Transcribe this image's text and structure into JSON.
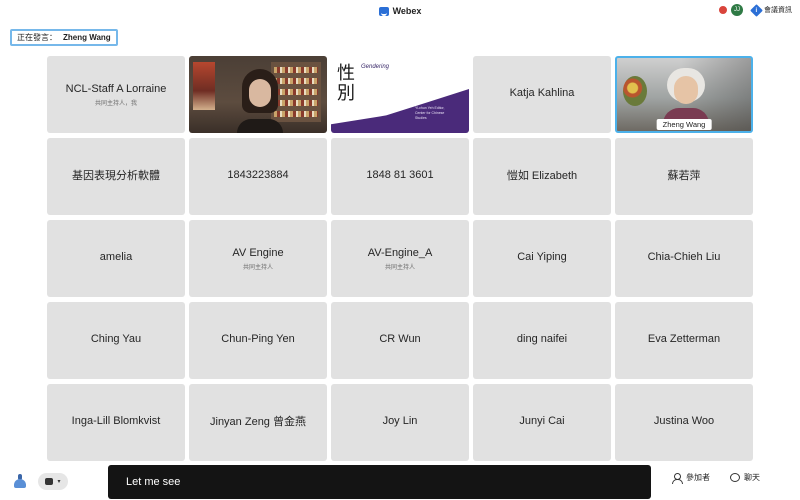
{
  "app": {
    "title": "Webex",
    "meeting_info_label": "會議資訊",
    "avatar_initials": "JJ"
  },
  "active_speaker": {
    "label": "正在發言：",
    "name": "Zheng Wang"
  },
  "video_tiles": {
    "slide": {
      "calligraphy": "性別",
      "title": "Gendering",
      "presenter_text": "Yi-chun Yeh Editor, Center for Chinese Studies"
    },
    "zheng_wang": {
      "name": "Zheng Wang"
    }
  },
  "participants": [
    {
      "name": "NCL-Staff A Lorraine",
      "role": "共同主持人，我"
    },
    {
      "name": "Katja Kahlina",
      "role": ""
    },
    {
      "name": "基因表現分析軟體",
      "role": ""
    },
    {
      "name": "1843223884",
      "role": ""
    },
    {
      "name": "1848 81 3601",
      "role": ""
    },
    {
      "name": "愷如 Elizabeth",
      "role": ""
    },
    {
      "name": "蘇若萍",
      "role": ""
    },
    {
      "name": "amelia",
      "role": ""
    },
    {
      "name": "AV Engine",
      "role": "共同主持人"
    },
    {
      "name": "AV-Engine_A",
      "role": "共同主持人"
    },
    {
      "name": "Cai Yiping",
      "role": ""
    },
    {
      "name": "Chia-Chieh Liu",
      "role": ""
    },
    {
      "name": "Ching Yau",
      "role": ""
    },
    {
      "name": "Chun-Ping Yen",
      "role": ""
    },
    {
      "name": "CR Wun",
      "role": ""
    },
    {
      "name": "ding naifei",
      "role": ""
    },
    {
      "name": "Eva Zetterman",
      "role": ""
    },
    {
      "name": "Inga-Lill Blomkvist",
      "role": ""
    },
    {
      "name": "Jinyan Zeng 曾金燕",
      "role": ""
    },
    {
      "name": "Joy Lin",
      "role": ""
    },
    {
      "name": "Junyi Cai",
      "role": ""
    },
    {
      "name": "Justina Woo",
      "role": ""
    }
  ],
  "bottom_bar": {
    "caption": "Let me see",
    "participants_label": "參加者",
    "chat_label": "聊天"
  },
  "colors": {
    "accent": "#4cb1ea",
    "caption_bg": "#141414",
    "tile_bg": "#e1e1e1"
  }
}
